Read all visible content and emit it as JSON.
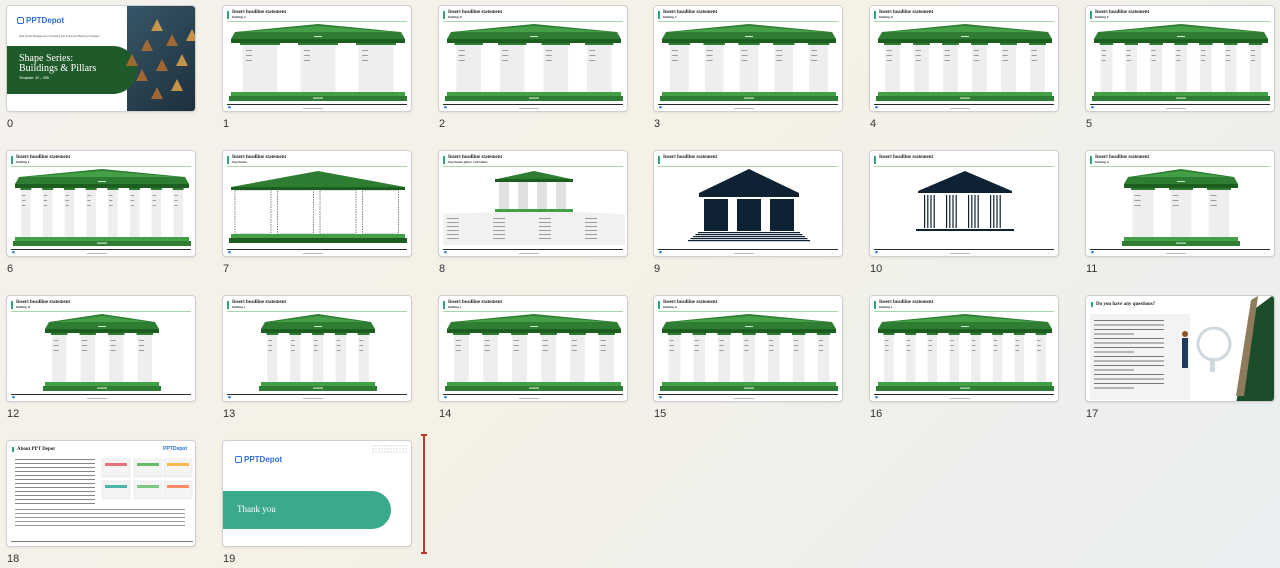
{
  "slides": [
    {
      "number": "0",
      "kind": "title",
      "logo": "PPTDepot",
      "subtitle": "High Impact Management Consulting and Investment Banking Templates",
      "title_line1": "Shape Series:",
      "title_line2": "Buildings & Pillars",
      "template": "Template: 42 – 055"
    },
    {
      "number": "1",
      "kind": "pillars",
      "headline": "Insert headline statement",
      "sub": "Building A",
      "pillars": 3
    },
    {
      "number": "2",
      "kind": "pillars",
      "headline": "Insert headline statement",
      "sub": "Building B",
      "pillars": 4
    },
    {
      "number": "3",
      "kind": "pillars",
      "headline": "Insert headline statement",
      "sub": "Building C",
      "pillars": 5
    },
    {
      "number": "4",
      "kind": "pillars",
      "headline": "Insert headline statement",
      "sub": "Building D",
      "pillars": 6
    },
    {
      "number": "5",
      "kind": "pillars",
      "headline": "Insert headline statement",
      "sub": "Building E",
      "pillars": 7
    },
    {
      "number": "6",
      "kind": "pillars",
      "headline": "Insert headline statement",
      "sub": "Building F",
      "pillars": 8
    },
    {
      "number": "7",
      "kind": "dashed",
      "headline": "Insert headline statement",
      "sub": "Placeholder",
      "pillars": 4
    },
    {
      "number": "8",
      "kind": "small-temple",
      "headline": "Insert headline statement",
      "sub": "Placeholder pillars with bullets",
      "pillars": 4
    },
    {
      "number": "9",
      "kind": "dark-temple",
      "headline": "Insert headline statement",
      "sub": ""
    },
    {
      "number": "10",
      "kind": "line-temple",
      "headline": "Insert headline statement",
      "sub": ""
    },
    {
      "number": "11",
      "kind": "pillars-narrow",
      "headline": "Insert headline statement",
      "sub": "Building G",
      "pillars": 3
    },
    {
      "number": "12",
      "kind": "pillars-narrow",
      "headline": "Insert headline statement",
      "sub": "Building H",
      "pillars": 4
    },
    {
      "number": "13",
      "kind": "pillars-narrow",
      "headline": "Insert headline statement",
      "sub": "Building I",
      "pillars": 5
    },
    {
      "number": "14",
      "kind": "pillars",
      "headline": "Insert headline statement",
      "sub": "Building J",
      "pillars": 6
    },
    {
      "number": "15",
      "kind": "pillars",
      "headline": "Insert headline statement",
      "sub": "Building K",
      "pillars": 7
    },
    {
      "number": "16",
      "kind": "pillars",
      "headline": "Insert headline statement",
      "sub": "Building L",
      "pillars": 8
    },
    {
      "number": "17",
      "kind": "questions",
      "headline": "Do you have any questions?"
    },
    {
      "number": "18",
      "kind": "about",
      "headline": "About PPT Depot",
      "logo": "PPTDepot"
    },
    {
      "number": "19",
      "kind": "thankyou",
      "logo": "PPTDepot",
      "text": "Thank you"
    }
  ],
  "colors": {
    "green_dark": "#1b5e20",
    "green": "#2e7d32",
    "green_light": "#43a047",
    "accent": "#2da47b",
    "navy": "#0f2233",
    "insert_marker": "#c0392b"
  }
}
